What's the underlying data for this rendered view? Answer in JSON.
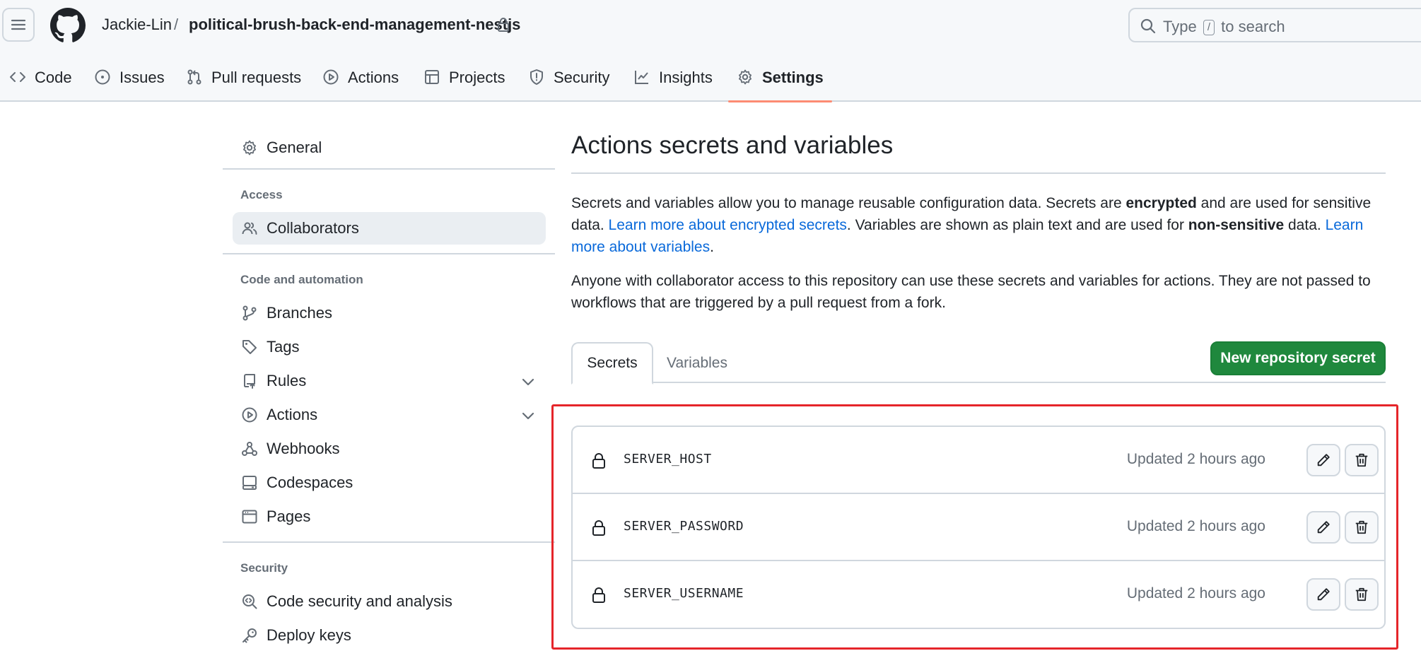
{
  "header": {
    "owner": "Jackie-Lin",
    "separator": "/",
    "repo": "political-brush-back-end-management-nestjs",
    "search_prefix": "Type",
    "search_key": "/",
    "search_suffix": "to search"
  },
  "repo_tabs": [
    {
      "label": "Code",
      "icon": "code-icon"
    },
    {
      "label": "Issues",
      "icon": "issue-icon"
    },
    {
      "label": "Pull requests",
      "icon": "pull-request-icon"
    },
    {
      "label": "Actions",
      "icon": "play-icon"
    },
    {
      "label": "Projects",
      "icon": "table-icon"
    },
    {
      "label": "Security",
      "icon": "shield-icon"
    },
    {
      "label": "Insights",
      "icon": "graph-icon"
    },
    {
      "label": "Settings",
      "icon": "gear-icon",
      "active": true
    }
  ],
  "sidebar": {
    "general": "General",
    "access_heading": "Access",
    "collaborators": "Collaborators",
    "code_heading": "Code and automation",
    "branches": "Branches",
    "tags": "Tags",
    "rules": "Rules",
    "actions": "Actions",
    "webhooks": "Webhooks",
    "codespaces": "Codespaces",
    "pages": "Pages",
    "security_heading": "Security",
    "code_security": "Code security and analysis",
    "deploy_keys": "Deploy keys"
  },
  "main": {
    "title": "Actions secrets and variables",
    "p1_a": "Secrets and variables allow you to manage reusable configuration data. Secrets are ",
    "p1_b": "encrypted",
    "p1_c": " and are used for sensitive data. ",
    "p1_link1": "Learn more about encrypted secrets",
    "p1_d": ". Variables are shown as plain text and are used for ",
    "p1_e": "non-sensitive",
    "p1_f": " data. ",
    "p1_link2": "Learn more about variables",
    "p1_g": ".",
    "p2": "Anyone with collaborator access to this repository can use these secrets and variables for actions. They are not passed to workflows that are triggered by a pull request from a fork.",
    "tab_secrets": "Secrets",
    "tab_variables": "Variables",
    "new_secret_button": "New repository secret"
  },
  "secrets": [
    {
      "name": "SERVER_HOST",
      "updated": "Updated 2 hours ago"
    },
    {
      "name": "SERVER_PASSWORD",
      "updated": "Updated 2 hours ago"
    },
    {
      "name": "SERVER_USERNAME",
      "updated": "Updated 2 hours ago"
    }
  ],
  "colors": {
    "accent_link": "#0969da",
    "primary_button": "#1f883d",
    "active_tab_underline": "#fd8c73",
    "highlight_box": "#e5252a"
  }
}
